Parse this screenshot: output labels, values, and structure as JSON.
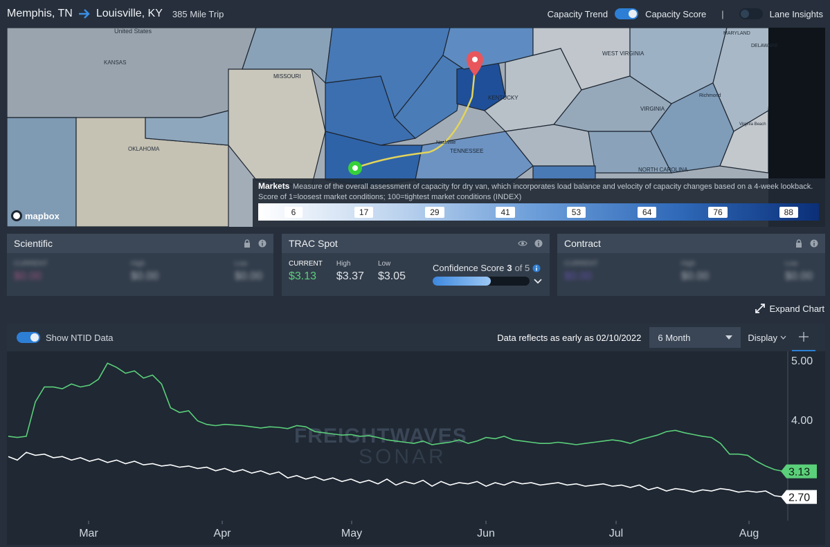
{
  "header": {
    "origin": "Memphis, TN",
    "destination": "Louisville, KY",
    "trip": "385 Mile Trip",
    "capacity_trend": "Capacity Trend",
    "capacity_score": "Capacity Score",
    "separator": "|",
    "lane_insights": "Lane Insights",
    "capacity_toggle_on": true,
    "lane_insights_on": false
  },
  "map": {
    "attribution": "mapbox",
    "place_labels": [
      "United States",
      "KANSAS",
      "MISSOURI",
      "OKLAHOMA",
      "TENNESSEE",
      "KENTUCKY",
      "WEST VIRGINIA",
      "VIRGINIA",
      "NORTH CAROLINA",
      "DELAWARE",
      "MARYLAND",
      "Nashville",
      "Richmond",
      "Virginia Beach"
    ],
    "legend": {
      "title": "Markets",
      "description": "Measure of the overall assessment of capacity for dry van, which incorporates load balance and velocity of capacity changes based on a 4-week lookback. Score of 1=loosest market conditions; 100=tightest market conditions (INDEX)",
      "ticks": [
        "6",
        "17",
        "29",
        "41",
        "53",
        "64",
        "76",
        "88"
      ]
    }
  },
  "cards": {
    "scientific": {
      "title": "Scientific",
      "current_label": "CURRENT",
      "current": "$0.00",
      "high_label": "High",
      "high": "$0.00",
      "low_label": "Low",
      "low": "$0.00"
    },
    "trac": {
      "title": "TRAC Spot",
      "current_label": "CURRENT",
      "current": "$3.13",
      "high_label": "High",
      "high": "$3.37",
      "low_label": "Low",
      "low": "$3.05",
      "confidence_label": "Confidence Score",
      "confidence_score": "3",
      "confidence_of": "of 5",
      "confidence_fraction": 0.6
    },
    "contract": {
      "title": "Contract",
      "current_label": "CURRENT",
      "current": "$0.00",
      "high_label": "High",
      "high": "$0.00",
      "low_label": "Low",
      "low": "$0.00"
    }
  },
  "expand_chart": "Expand Chart",
  "chart_toolbar": {
    "show_ntid": "Show NTID Data",
    "show_ntid_on": true,
    "reflects": "Data reflects as early as 02/10/2022",
    "range": "6 Month",
    "display": "Display"
  },
  "chart_data": {
    "type": "line",
    "watermark_line1": "FREIGHTWAVES",
    "watermark_line2": "SONAR",
    "x_ticks": [
      "Mar",
      "Apr",
      "May",
      "Jun",
      "Jul",
      "Aug"
    ],
    "y_ticks": [
      "5.00",
      "4.00"
    ],
    "ylim": [
      2.3,
      5.15
    ],
    "grid": false,
    "series": [
      {
        "color": "#5bd07a",
        "last_label": "3.13",
        "values": [
          3.72,
          3.7,
          3.72,
          4.3,
          4.55,
          4.55,
          4.52,
          4.6,
          4.55,
          4.58,
          4.68,
          4.95,
          4.88,
          4.78,
          4.82,
          4.7,
          4.75,
          4.6,
          4.2,
          4.12,
          4.15,
          3.98,
          3.92,
          3.9,
          3.92,
          3.91,
          3.9,
          3.88,
          3.86,
          3.88,
          3.87,
          3.85,
          3.9,
          3.88,
          3.8,
          3.78,
          3.76,
          3.74,
          3.75,
          3.72,
          3.73,
          3.7,
          3.66,
          3.64,
          3.62,
          3.6,
          3.64,
          3.58,
          3.6,
          3.62,
          3.66,
          3.6,
          3.64,
          3.7,
          3.68,
          3.72,
          3.66,
          3.64,
          3.62,
          3.6,
          3.6,
          3.62,
          3.6,
          3.58,
          3.6,
          3.62,
          3.64,
          3.66,
          3.64,
          3.6,
          3.66,
          3.7,
          3.74,
          3.8,
          3.82,
          3.78,
          3.75,
          3.72,
          3.7,
          3.6,
          3.42,
          3.42,
          3.4,
          3.3,
          3.22,
          3.16,
          3.13
        ]
      },
      {
        "color": "#ffffff",
        "last_label": "2.70",
        "values": [
          3.38,
          3.32,
          3.45,
          3.4,
          3.42,
          3.36,
          3.38,
          3.32,
          3.36,
          3.3,
          3.34,
          3.28,
          3.32,
          3.26,
          3.3,
          3.24,
          3.26,
          3.22,
          3.24,
          3.2,
          3.22,
          3.18,
          3.2,
          3.14,
          3.18,
          3.12,
          3.16,
          3.1,
          3.14,
          3.08,
          3.12,
          3.02,
          3.06,
          3.0,
          3.04,
          2.98,
          3.02,
          2.96,
          3.0,
          2.94,
          2.98,
          2.92,
          3.0,
          2.9,
          2.96,
          2.92,
          2.98,
          2.88,
          2.96,
          2.9,
          2.94,
          2.92,
          2.96,
          2.88,
          2.94,
          2.9,
          2.96,
          2.92,
          2.94,
          2.9,
          2.92,
          2.94,
          2.9,
          2.92,
          2.88,
          2.9,
          2.92,
          2.88,
          2.9,
          2.86,
          2.9,
          2.82,
          2.86,
          2.8,
          2.84,
          2.82,
          2.78,
          2.82,
          2.8,
          2.84,
          2.82,
          2.78,
          2.8,
          2.78,
          2.8,
          2.72,
          2.7
        ]
      }
    ]
  }
}
